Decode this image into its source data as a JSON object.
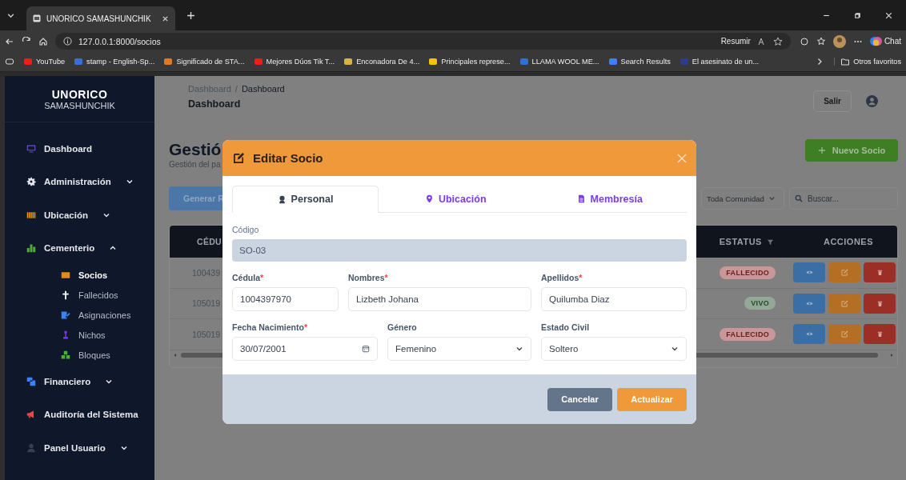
{
  "browser": {
    "tab_title": "UNORICO SAMASHUNCHIK",
    "url": "127.0.0.1:8000/socios",
    "summarize_label": "Resumir",
    "chat_label": "Chat",
    "bookmarks": [
      {
        "label": "YouTube",
        "color": "#e62117"
      },
      {
        "label": "stamp - English-Sp...",
        "color": "#3b6fd8"
      },
      {
        "label": "Significado de STA...",
        "color": "#e0782a"
      },
      {
        "label": "Mejores Dúos Tik T...",
        "color": "#e62117"
      },
      {
        "label": "Enconadora De 4...",
        "color": "#d9b24a"
      },
      {
        "label": "Principales represe...",
        "color": "#f2c40f"
      },
      {
        "label": "LLAMA WOOL ME...",
        "color": "#2f6fd6"
      },
      {
        "label": "Search Results",
        "color": "#3b82f6"
      },
      {
        "label": "El asesinato de un...",
        "color": "#2a3e8c"
      }
    ],
    "other_bookmarks": "Otros favoritos"
  },
  "sidebar": {
    "brand": "UNORICO",
    "brand_sub": "SAMASHUNCHIK",
    "items": [
      {
        "label": "Dashboard",
        "selected": false
      },
      {
        "label": "Administración",
        "selected": false,
        "expanded": false
      },
      {
        "label": "Ubicación",
        "selected": false,
        "expanded": false
      },
      {
        "label": "Cementerio",
        "selected": false,
        "expanded": true,
        "children": [
          {
            "label": "Socios",
            "selected": true
          },
          {
            "label": "Fallecidos",
            "selected": false
          },
          {
            "label": "Asignaciones",
            "selected": false
          },
          {
            "label": "Nichos",
            "selected": false
          },
          {
            "label": "Bloques",
            "selected": false
          }
        ]
      },
      {
        "label": "Financiero",
        "selected": false,
        "expanded": false
      },
      {
        "label": "Auditoría del Sistema",
        "selected": false
      },
      {
        "label": "Panel Usuario",
        "selected": false,
        "expanded": false
      }
    ]
  },
  "header": {
    "breadcrumb": [
      "Dashboard",
      "Dashboard"
    ],
    "breadcrumb_separator": "/",
    "title": "Dashboard",
    "logout_label": "Salir"
  },
  "page": {
    "title": "Gestió",
    "subtitle": "Gestión del pa",
    "new_button": "Nuevo Socio",
    "report_button": "Generar R",
    "community_filter": "Toda Comunidad",
    "search": {
      "placeholder": "Buscar..."
    }
  },
  "table": {
    "columns": [
      "CÉDU",
      "ESTATUS",
      "ACCIONES"
    ],
    "rows": [
      {
        "cedula": "100439",
        "status": "FALLECIDO",
        "kind": "danger"
      },
      {
        "cedula": "105019",
        "status": "VIVO",
        "kind": "success"
      },
      {
        "cedula": "105019",
        "status": "FALLECIDO",
        "kind": "danger"
      }
    ]
  },
  "modal": {
    "title": "Editar Socio",
    "tabs": [
      {
        "label": "Personal",
        "selected": true
      },
      {
        "label": "Ubicación",
        "selected": false
      },
      {
        "label": "Membresía",
        "selected": false
      }
    ],
    "code": {
      "label": "Código",
      "value": "SO-03"
    },
    "fields": [
      {
        "label": "Cédula",
        "required": true,
        "kind": "text",
        "value": "1004397970"
      },
      {
        "label": "Nombres",
        "required": true,
        "kind": "text",
        "value": "Lizbeth Johana"
      },
      {
        "label": "Apellidos",
        "required": true,
        "kind": "text",
        "value": "Quilumba Diaz"
      },
      {
        "label": "Fecha Nacimiento",
        "required": true,
        "kind": "date",
        "value": "30/07/2001"
      },
      {
        "label": "Género",
        "required": false,
        "kind": "select",
        "value": "Femenino"
      },
      {
        "label": "Estado Civil",
        "required": false,
        "kind": "select",
        "value": "Soltero"
      }
    ],
    "required_mark": "*",
    "buttons": [
      {
        "label": "Cancelar",
        "kind": "secondary"
      },
      {
        "label": "Actualizar",
        "kind": "primary"
      }
    ]
  }
}
